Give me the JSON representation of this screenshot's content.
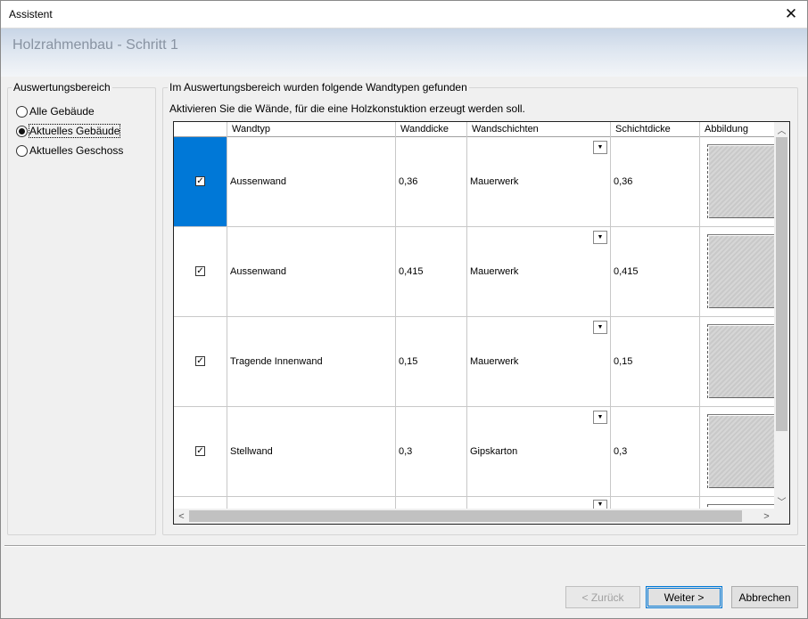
{
  "window": {
    "title": "Assistent",
    "close_glyph": "✕"
  },
  "banner": {
    "step_title": "Holzrahmenbau - Schritt 1"
  },
  "scope_group": {
    "legend": "Auswertungsbereich",
    "options": [
      {
        "label": "Alle Gebäude",
        "selected": false
      },
      {
        "label": "Aktuelles Gebäude",
        "selected": true
      },
      {
        "label": "Aktuelles Geschoss",
        "selected": false
      }
    ]
  },
  "walls_group": {
    "legend": "Im Auswertungsbereich wurden folgende Wandtypen gefunden",
    "hint": "Aktivieren Sie die Wände, für die eine Holzkonstuktion erzeugt werden soll.",
    "columns": [
      "",
      "Wandtyp",
      "Wanddicke",
      "Wandschichten",
      "Schichtdicke",
      "Abbildung"
    ],
    "rows": [
      {
        "checked": true,
        "wall_type": "Aussenwand",
        "thickness": "0,36",
        "layer": "Mauerwerk",
        "layer_thickness": "0,36"
      },
      {
        "checked": true,
        "wall_type": "Aussenwand",
        "thickness": "0,415",
        "layer": "Mauerwerk",
        "layer_thickness": "0,415"
      },
      {
        "checked": true,
        "wall_type": "Tragende Innenwand",
        "thickness": "0,15",
        "layer": "Mauerwerk",
        "layer_thickness": "0,15"
      },
      {
        "checked": true,
        "wall_type": "Stellwand",
        "thickness": "0,3",
        "layer": "Gipskarton",
        "layer_thickness": "0,3"
      }
    ],
    "dropdown_glyph": "▼",
    "check_glyph": "✓"
  },
  "buttons": {
    "back": "< Zurück",
    "next": "Weiter >",
    "cancel": "Abbrechen"
  },
  "icons": {
    "scroll_up": "chevron-up-icon",
    "scroll_down": "chevron-down-icon",
    "scroll_left": "chevron-left-icon",
    "scroll_right": "chevron-right-icon"
  },
  "colors": {
    "selection": "#0078d7",
    "banner_top": "#c8d5e6"
  }
}
